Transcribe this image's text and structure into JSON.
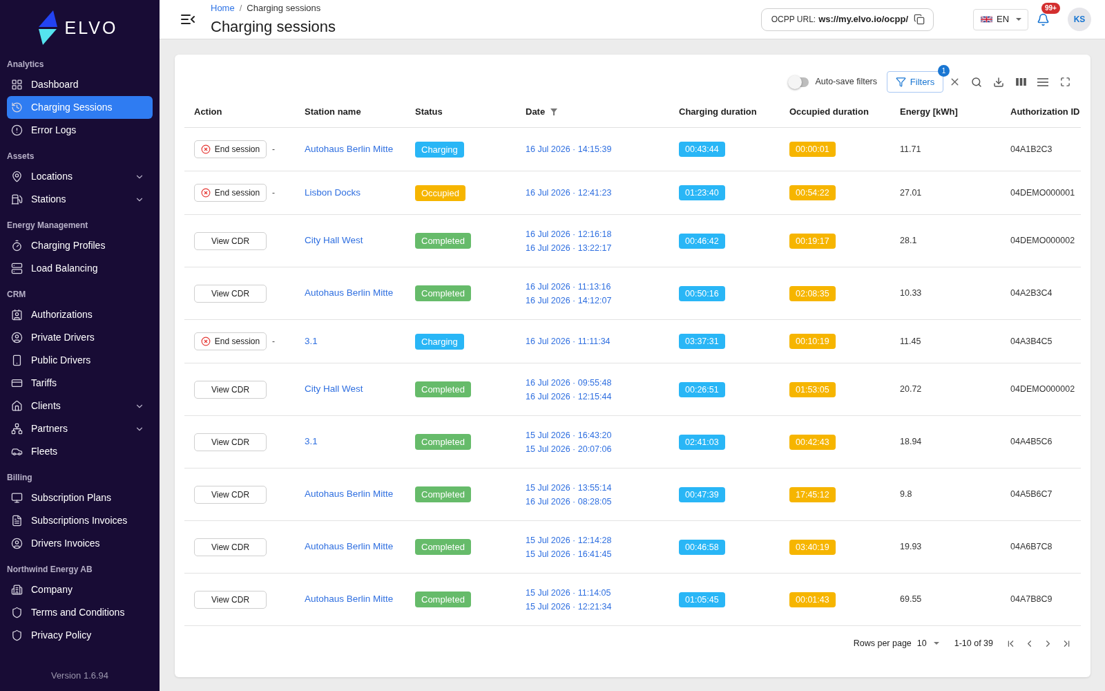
{
  "sidebar": {
    "logo": "ELVO",
    "sections": [
      {
        "title": "Analytics",
        "items": [
          {
            "label": "Dashboard",
            "selected": false,
            "submenu": false
          },
          {
            "label": "Charging Sessions",
            "selected": true,
            "submenu": false
          },
          {
            "label": "Error Logs",
            "selected": false,
            "submenu": false
          }
        ]
      },
      {
        "title": "Assets",
        "items": [
          {
            "label": "Locations",
            "selected": false,
            "submenu": true
          },
          {
            "label": "Stations",
            "selected": false,
            "submenu": true
          }
        ]
      },
      {
        "title": "Energy Management",
        "items": [
          {
            "label": "Charging Profiles",
            "selected": false,
            "submenu": false
          },
          {
            "label": "Load Balancing",
            "selected": false,
            "submenu": false
          }
        ]
      },
      {
        "title": "CRM",
        "items": [
          {
            "label": "Authorizations",
            "selected": false,
            "submenu": false
          },
          {
            "label": "Private Drivers",
            "selected": false,
            "submenu": false
          },
          {
            "label": "Public Drivers",
            "selected": false,
            "submenu": false
          },
          {
            "label": "Tariffs",
            "selected": false,
            "submenu": false
          },
          {
            "label": "Clients",
            "selected": false,
            "submenu": true
          },
          {
            "label": "Partners",
            "selected": false,
            "submenu": true
          },
          {
            "label": "Fleets",
            "selected": false,
            "submenu": false
          }
        ]
      },
      {
        "title": "Billing",
        "items": [
          {
            "label": "Subscription Plans",
            "selected": false,
            "submenu": false
          },
          {
            "label": "Subscriptions Invoices",
            "selected": false,
            "submenu": false
          },
          {
            "label": "Drivers Invoices",
            "selected": false,
            "submenu": false
          }
        ]
      },
      {
        "title": "Northwind Energy AB",
        "items": [
          {
            "label": "Company",
            "selected": false,
            "submenu": false
          },
          {
            "label": "Terms and Conditions",
            "selected": false,
            "submenu": false
          },
          {
            "label": "Privacy Policy",
            "selected": false,
            "submenu": false
          }
        ]
      }
    ],
    "version": "Version 1.6.94"
  },
  "header": {
    "breadcrumb": [
      {
        "label": "Home",
        "link": true
      },
      {
        "label": "Charging sessions",
        "link": false
      }
    ],
    "breadcrumb_separator": "/",
    "title": "Charging sessions",
    "ocpp": {
      "label": "OCPP URL:",
      "value": "ws://my.elvo.io/ocpp/"
    },
    "language": "EN",
    "notifications_badge": "99+",
    "avatar_initials": "KS"
  },
  "toolbar": {
    "auto_save": {
      "label": "Auto-save filters",
      "on": false
    },
    "filters": {
      "label": "Filters",
      "badge": "1"
    }
  },
  "table": {
    "columns": [
      {
        "label": "Action",
        "filtered": false
      },
      {
        "label": "Station name",
        "filtered": false
      },
      {
        "label": "Status",
        "filtered": false
      },
      {
        "label": "Date",
        "filtered": true
      },
      {
        "label": "Charging duration",
        "filtered": false
      },
      {
        "label": "Occupied duration",
        "filtered": false
      },
      {
        "label": "Energy [kWh]",
        "filtered": false
      },
      {
        "label": "Authorization ID",
        "filtered": false
      }
    ],
    "rows": [
      {
        "action": {
          "kind": "end_session",
          "label": "End session",
          "note": "-"
        },
        "station": "Autohaus Berlin Mitte",
        "status": {
          "label": "Charging",
          "color": "#29b6f6"
        },
        "dates": [
          "16 Jul 2026 · 14:15:39"
        ],
        "charging_duration": "00:43:44",
        "occupied_duration": "00:00:01",
        "energy": "11.71",
        "authorization_id": "04A1B2C3"
      },
      {
        "action": {
          "kind": "end_session",
          "label": "End session",
          "note": "-"
        },
        "station": "Lisbon Docks",
        "status": {
          "label": "Occupied",
          "color": "#f6b500"
        },
        "dates": [
          "16 Jul 2026 · 12:41:23"
        ],
        "charging_duration": "01:23:40",
        "occupied_duration": "00:54:22",
        "energy": "27.01",
        "authorization_id": "04DEMO000001"
      },
      {
        "action": {
          "kind": "view_cdr",
          "label": "View CDR"
        },
        "station": "City Hall West",
        "status": {
          "label": "Completed",
          "color": "#66bb6a"
        },
        "dates": [
          "16 Jul 2026 · 12:16:18",
          "16 Jul 2026 · 13:22:17"
        ],
        "charging_duration": "00:46:42",
        "occupied_duration": "00:19:17",
        "energy": "28.1",
        "authorization_id": "04DEMO000002"
      },
      {
        "action": {
          "kind": "view_cdr",
          "label": "View CDR"
        },
        "station": "Autohaus Berlin Mitte",
        "status": {
          "label": "Completed",
          "color": "#66bb6a"
        },
        "dates": [
          "16 Jul 2026 · 11:13:16",
          "16 Jul 2026 · 14:12:07"
        ],
        "charging_duration": "00:50:16",
        "occupied_duration": "02:08:35",
        "energy": "10.33",
        "authorization_id": "04A2B3C4"
      },
      {
        "action": {
          "kind": "end_session",
          "label": "End session",
          "note": "-"
        },
        "station": "3.1",
        "status": {
          "label": "Charging",
          "color": "#29b6f6"
        },
        "dates": [
          "16 Jul 2026 · 11:11:34"
        ],
        "charging_duration": "03:37:31",
        "occupied_duration": "00:10:19",
        "energy": "11.45",
        "authorization_id": "04A3B4C5"
      },
      {
        "action": {
          "kind": "view_cdr",
          "label": "View CDR"
        },
        "station": "City Hall West",
        "status": {
          "label": "Completed",
          "color": "#66bb6a"
        },
        "dates": [
          "16 Jul 2026 · 09:55:48",
          "16 Jul 2026 · 12:15:44"
        ],
        "charging_duration": "00:26:51",
        "occupied_duration": "01:53:05",
        "energy": "20.72",
        "authorization_id": "04DEMO000002"
      },
      {
        "action": {
          "kind": "view_cdr",
          "label": "View CDR"
        },
        "station": "3.1",
        "status": {
          "label": "Completed",
          "color": "#66bb6a"
        },
        "dates": [
          "15 Jul 2026 · 16:43:20",
          "15 Jul 2026 · 20:07:06"
        ],
        "charging_duration": "02:41:03",
        "occupied_duration": "00:42:43",
        "energy": "18.94",
        "authorization_id": "04A4B5C6"
      },
      {
        "action": {
          "kind": "view_cdr",
          "label": "View CDR"
        },
        "station": "Autohaus Berlin Mitte",
        "status": {
          "label": "Completed",
          "color": "#66bb6a"
        },
        "dates": [
          "15 Jul 2026 · 13:55:14",
          "16 Jul 2026 · 08:28:05"
        ],
        "charging_duration": "00:47:39",
        "occupied_duration": "17:45:12",
        "energy": "9.8",
        "authorization_id": "04A5B6C7"
      },
      {
        "action": {
          "kind": "view_cdr",
          "label": "View CDR"
        },
        "station": "Autohaus Berlin Mitte",
        "status": {
          "label": "Completed",
          "color": "#66bb6a"
        },
        "dates": [
          "15 Jul 2026 · 12:14:28",
          "15 Jul 2026 · 16:41:45"
        ],
        "charging_duration": "00:46:58",
        "occupied_duration": "03:40:19",
        "energy": "19.93",
        "authorization_id": "04A6B7C8"
      },
      {
        "action": {
          "kind": "view_cdr",
          "label": "View CDR"
        },
        "station": "Autohaus Berlin Mitte",
        "status": {
          "label": "Completed",
          "color": "#66bb6a"
        },
        "dates": [
          "15 Jul 2026 · 11:14:05",
          "15 Jul 2026 · 12:21:34"
        ],
        "charging_duration": "01:05:45",
        "occupied_duration": "00:01:43",
        "energy": "69.55",
        "authorization_id": "04A7B8C9"
      }
    ]
  },
  "pagination": {
    "rows_per_page_label": "Rows per page",
    "rows_per_page": "10",
    "range": "1-10 of 39"
  }
}
